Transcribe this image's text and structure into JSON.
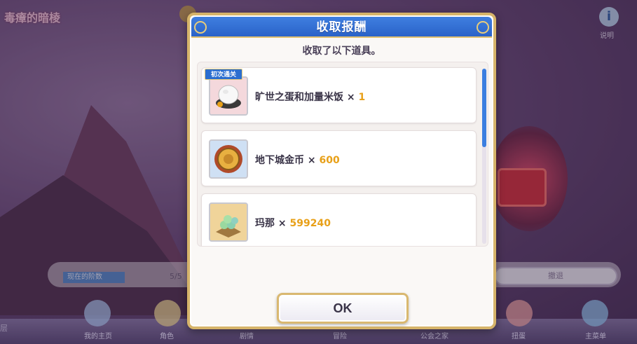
{
  "background": {
    "title": "毒瘴的暗棱",
    "info_label": "说明",
    "floor_label": "现在的阶数",
    "floor_count": "5/5",
    "retreat_label": "撤退",
    "side_label": "层",
    "nav_items": [
      "我的主页",
      "角色",
      "剧情",
      "冒险",
      "公会之家",
      "扭蛋",
      "主菜单"
    ]
  },
  "dialog": {
    "title": "收取报酬",
    "subtitle": "收取了以下道具。",
    "ok_label": "OK",
    "items": [
      {
        "name": "旷世之蛋和加量米饭",
        "times": "×",
        "qty": "1",
        "badge": "初次通关",
        "icon": "rice-bowl-icon"
      },
      {
        "name": "地下城金币",
        "times": "×",
        "qty": "600",
        "icon": "dungeon-coin-icon"
      },
      {
        "name": "玛那",
        "times": "×",
        "qty": "599240",
        "icon": "mana-icon"
      }
    ]
  },
  "colors": {
    "header_blue": "#2a62c8",
    "accent_gold": "#d6b46a",
    "quantity_orange": "#e8a018"
  }
}
